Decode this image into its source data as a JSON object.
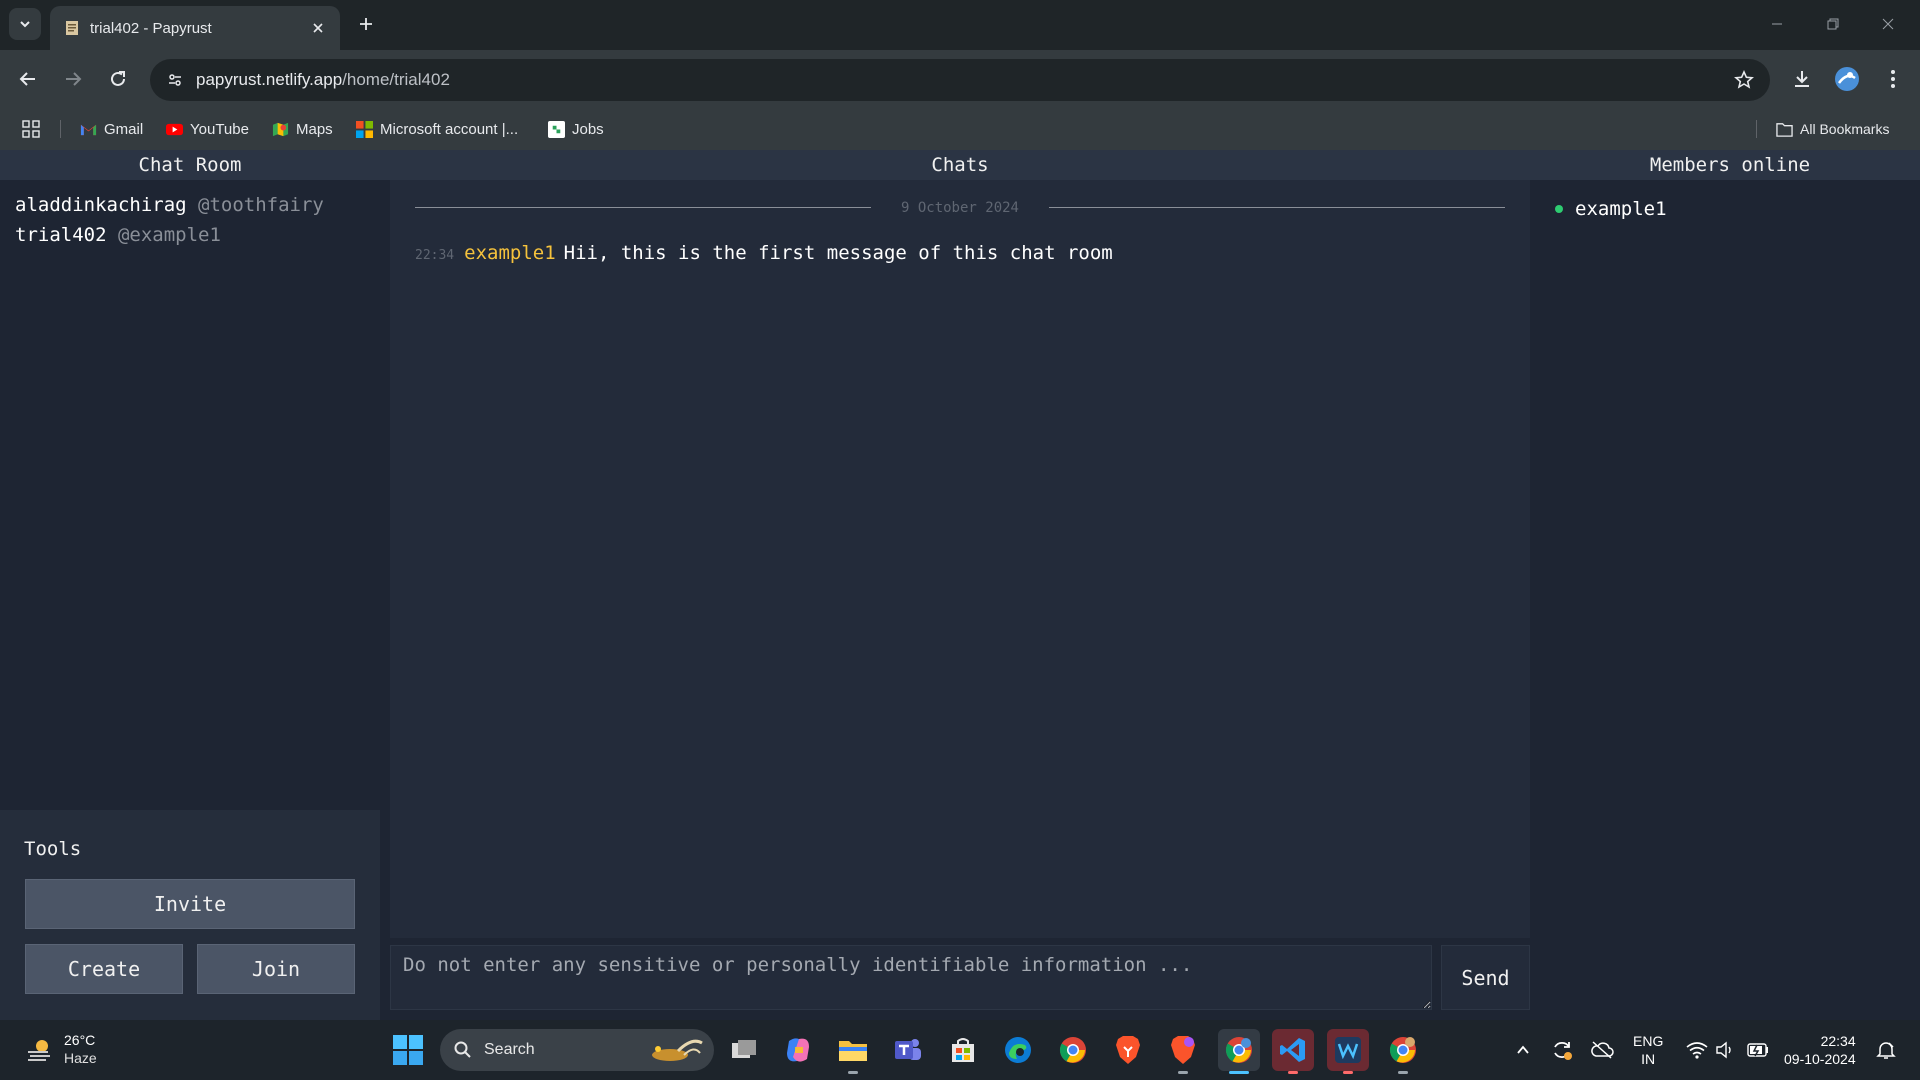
{
  "browser": {
    "tab_title": "trial402 - Papyrust",
    "url_host": "papyrust.netlify.app",
    "url_path": "/home/trial402",
    "bookmarks": [
      {
        "label": "Gmail",
        "icon": "gmail-icon"
      },
      {
        "label": "YouTube",
        "icon": "youtube-icon"
      },
      {
        "label": "Maps",
        "icon": "maps-icon"
      },
      {
        "label": "Microsoft account |...",
        "icon": "microsoft-icon"
      },
      {
        "label": "Jobs",
        "icon": "jobs-icon"
      }
    ],
    "all_bookmarks_label": "All Bookmarks"
  },
  "app": {
    "left_title": "Chat Room",
    "center_title": "Chats",
    "right_title": "Members online",
    "rooms": [
      {
        "name": "aladdinkachirag",
        "owner": "@toothfairy"
      },
      {
        "name": "trial402",
        "owner": "@example1"
      }
    ],
    "tools": {
      "title": "Tools",
      "invite": "Invite",
      "create": "Create",
      "join": "Join"
    },
    "chat": {
      "date": "9 October 2024",
      "messages": [
        {
          "time": "22:34",
          "user": "example1",
          "text": "Hii, this is the first message of this chat room"
        }
      ],
      "input_placeholder": "Do not enter any sensitive or personally identifiable information ...",
      "send_label": "Send"
    },
    "members": [
      {
        "name": "example1",
        "status": "online"
      }
    ],
    "colors": {
      "username": "#f5c23c",
      "online": "#2ecc71",
      "background": "#1e2533"
    }
  },
  "taskbar": {
    "weather_temp": "26°C",
    "weather_cond": "Haze",
    "search_label": "Search",
    "lang_line1": "ENG",
    "lang_line2": "IN",
    "time": "22:34",
    "date": "09-10-2024"
  }
}
